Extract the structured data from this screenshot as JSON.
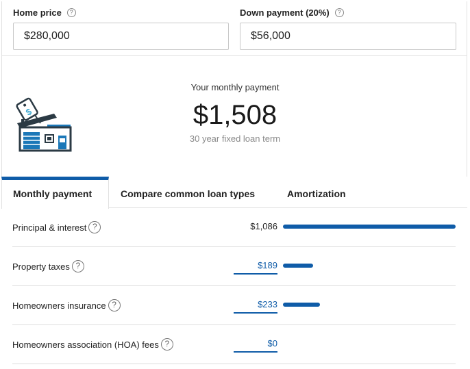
{
  "inputs": {
    "home_price": {
      "label": "Home price",
      "value": "$280,000"
    },
    "down_payment": {
      "label": "Down payment (20%)",
      "value": "$56,000"
    }
  },
  "summary": {
    "title": "Your monthly payment",
    "amount": "$1,508",
    "term": "30 year fixed loan term"
  },
  "tabs": [
    {
      "label": "Monthly payment",
      "active": true
    },
    {
      "label": "Compare common loan types",
      "active": false
    },
    {
      "label": "Amortization",
      "active": false
    }
  ],
  "breakdown": [
    {
      "label": "Principal & interest",
      "value": "$1,086",
      "editable": false,
      "share": 1.0
    },
    {
      "label": "Property taxes",
      "value": "$189",
      "editable": true,
      "share": 0.174
    },
    {
      "label": "Homeowners insurance",
      "value": "$233",
      "editable": true,
      "share": 0.215
    },
    {
      "label": "Homeowners association (HOA) fees",
      "value": "$0",
      "editable": true,
      "share": 0
    }
  ],
  "help_glyph": "?",
  "colors": {
    "accent": "#0f5ca8",
    "house_dark": "#2b3a44",
    "house_blue": "#1c78b8",
    "tag_teal": "#3aa7d0"
  }
}
